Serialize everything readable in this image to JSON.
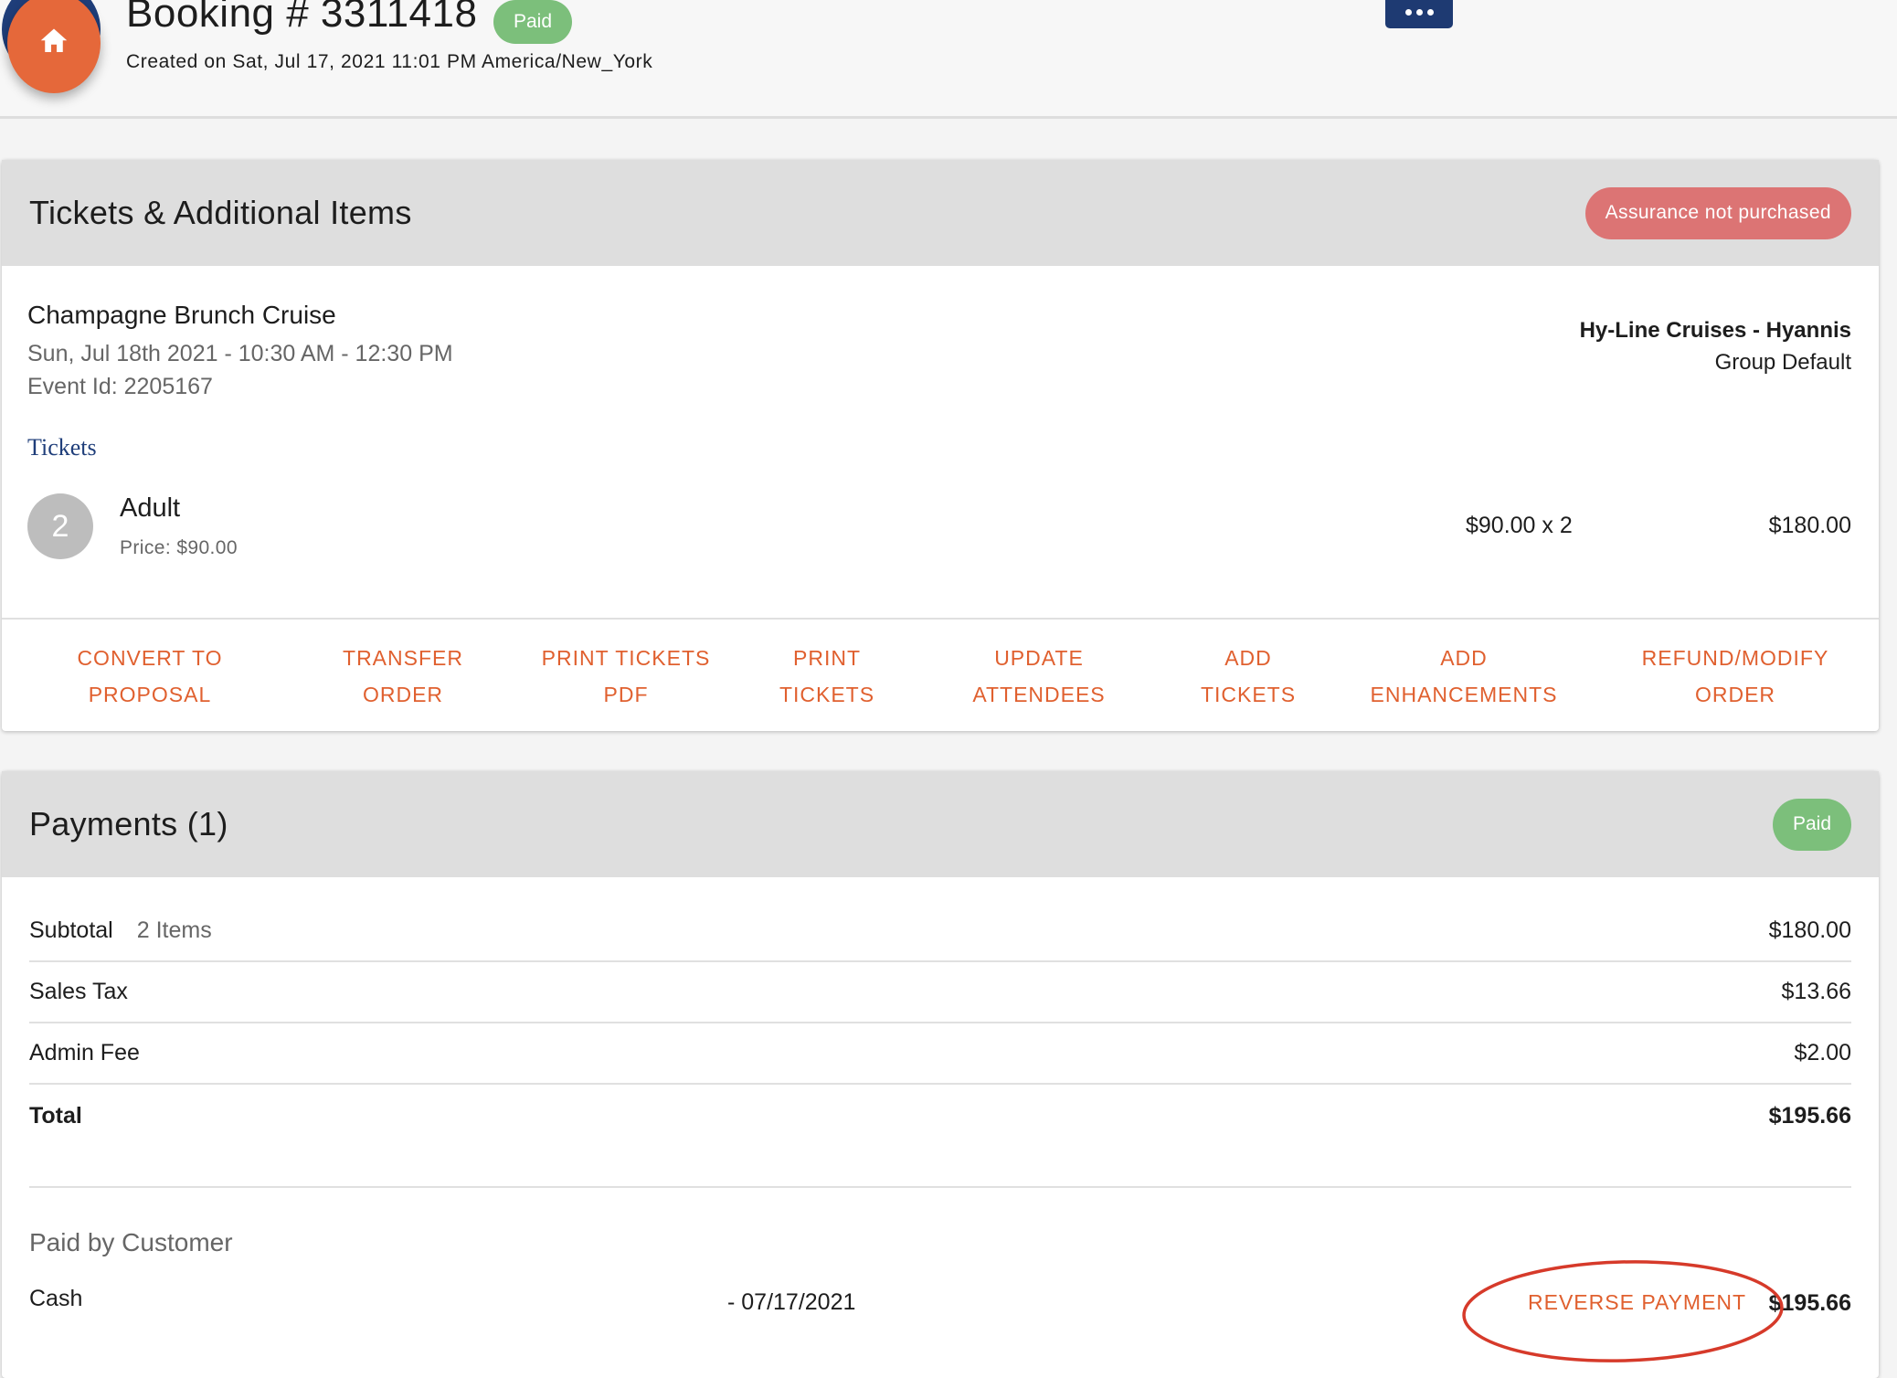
{
  "header": {
    "title": "Booking # 3311418",
    "status": "Paid",
    "created": "Created on Sat, Jul 17, 2021 11:01 PM America/New_York",
    "home_icon": "home-icon",
    "more_icon": "more-horizontal-icon"
  },
  "tickets_section": {
    "title": "Tickets & Additional Items",
    "assurance_badge": "Assurance not purchased",
    "event": {
      "name": "Champagne Brunch Cruise",
      "datetime": "Sun, Jul 18th 2021 - 10:30 AM - 12:30 PM",
      "event_id": "Event Id: 2205167",
      "vendor": "Hy-Line Cruises - Hyannis",
      "group": "Group Default"
    },
    "tickets_label": "Tickets",
    "tickets": [
      {
        "quantity": "2",
        "type": "Adult",
        "price": "Price: $90.00",
        "calc": "$90.00 x 2",
        "total": "$180.00"
      }
    ],
    "actions": [
      {
        "line1": "CONVERT TO",
        "line2": "PROPOSAL"
      },
      {
        "line1": "TRANSFER",
        "line2": "ORDER"
      },
      {
        "line1": "PRINT TICKETS",
        "line2": "PDF"
      },
      {
        "line1": "PRINT",
        "line2": "TICKETS"
      },
      {
        "line1": "UPDATE",
        "line2": "ATTENDEES"
      },
      {
        "line1": "ADD",
        "line2": "TICKETS"
      },
      {
        "line1": "ADD",
        "line2": "ENHANCEMENTS"
      },
      {
        "line1": "REFUND/MODIFY",
        "line2": "ORDER"
      }
    ]
  },
  "payments_section": {
    "title": "Payments (1)",
    "status": "Paid",
    "subtotal": {
      "label": "Subtotal",
      "items": "2 Items",
      "amount": "$180.00"
    },
    "sales_tax": {
      "label": "Sales Tax",
      "amount": "$13.66"
    },
    "admin_fee": {
      "label": "Admin Fee",
      "amount": "$2.00"
    },
    "total": {
      "label": "Total",
      "amount": "$195.66"
    },
    "paid_by_label": "Paid by Customer",
    "payment": {
      "method": "Cash",
      "date": "- 07/17/2021",
      "action": "REVERSE PAYMENT",
      "amount": "$195.66"
    }
  },
  "colors": {
    "accent_orange": "#e0602f",
    "paid_green": "#7cbf7b",
    "assurance_red": "#dc7474",
    "navy": "#1f3e7a",
    "annotation_red": "#d63a2a"
  }
}
